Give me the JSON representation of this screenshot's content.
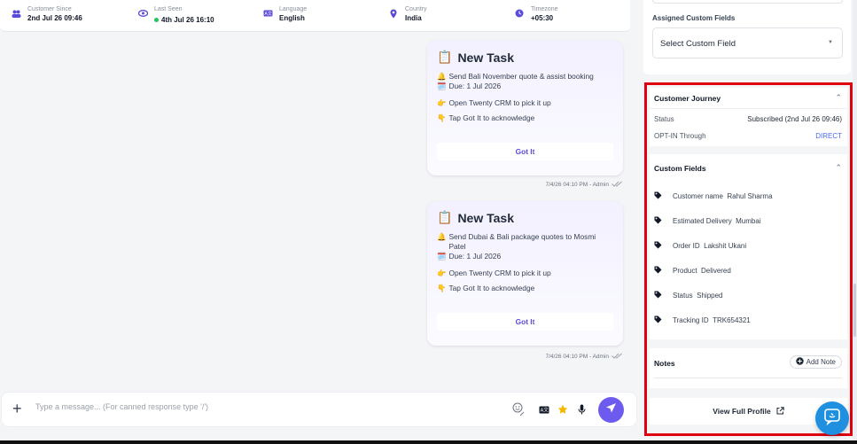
{
  "topbar": {
    "items": [
      {
        "icon": "users-icon",
        "label": "Customer Since",
        "value": "2nd Jul 26 09:46"
      },
      {
        "icon": "eye-icon",
        "label": "Last Seen",
        "value": "4th Jul 26 16:10",
        "online": true
      },
      {
        "icon": "language-icon",
        "label": "Language",
        "value": "English"
      },
      {
        "icon": "location-pin-icon",
        "label": "Country",
        "value": "India"
      },
      {
        "icon": "clock-icon",
        "label": "Timezone",
        "value": "+05:30"
      }
    ]
  },
  "messages": [
    {
      "title": "New Task",
      "task_line": "Send Bali November quote & assist booking",
      "due": "Due: 1 Jul 2026",
      "instruction_1": "Open Twenty CRM to pick it up",
      "instruction_2": "Tap Got It to acknowledge",
      "button": "Got It",
      "meta": "7/4/26 04:10 PM - Admin"
    },
    {
      "title": "New Task",
      "task_line": "Send Dubai & Bali package quotes to Mosmi Patel",
      "due": "Due: 1 Jul 2026",
      "instruction_1": "Open Twenty CRM to pick it up",
      "instruction_2": "Tap Got It to acknowledge",
      "button": "Got It",
      "meta": "7/4/26 04:10 PM - Admin"
    }
  ],
  "composer": {
    "placeholder": "Type a message... (For canned response type '/')"
  },
  "assigned_custom_fields": {
    "heading": "Assigned Custom Fields",
    "select_value": "Select Custom Field"
  },
  "customer_journey": {
    "heading": "Customer Journey",
    "status_label": "Status",
    "status_value": "Subscribed (2nd Jul 26 09:46)",
    "optin_label": "OPT-IN Through",
    "optin_value": "DIRECT"
  },
  "custom_fields": {
    "heading": "Custom Fields",
    "items": [
      {
        "key": "Customer name",
        "value": "Rahul Sharma"
      },
      {
        "key": "Estimated Delivery",
        "value": "Mumbai"
      },
      {
        "key": "Order ID",
        "value": "Lakshit Ukani"
      },
      {
        "key": "Product",
        "value": "Delivered"
      },
      {
        "key": "Status",
        "value": "Shipped"
      },
      {
        "key": "Tracking ID",
        "value": "TRK654321"
      }
    ]
  },
  "notes": {
    "heading": "Notes",
    "add_label": "Add Note"
  },
  "view_full_profile": "View Full Profile",
  "colors": {
    "accent": "#6d5bf0",
    "highlight_border": "#e0000f",
    "link": "#4a6cf0",
    "fab": "#1f8fe0"
  }
}
